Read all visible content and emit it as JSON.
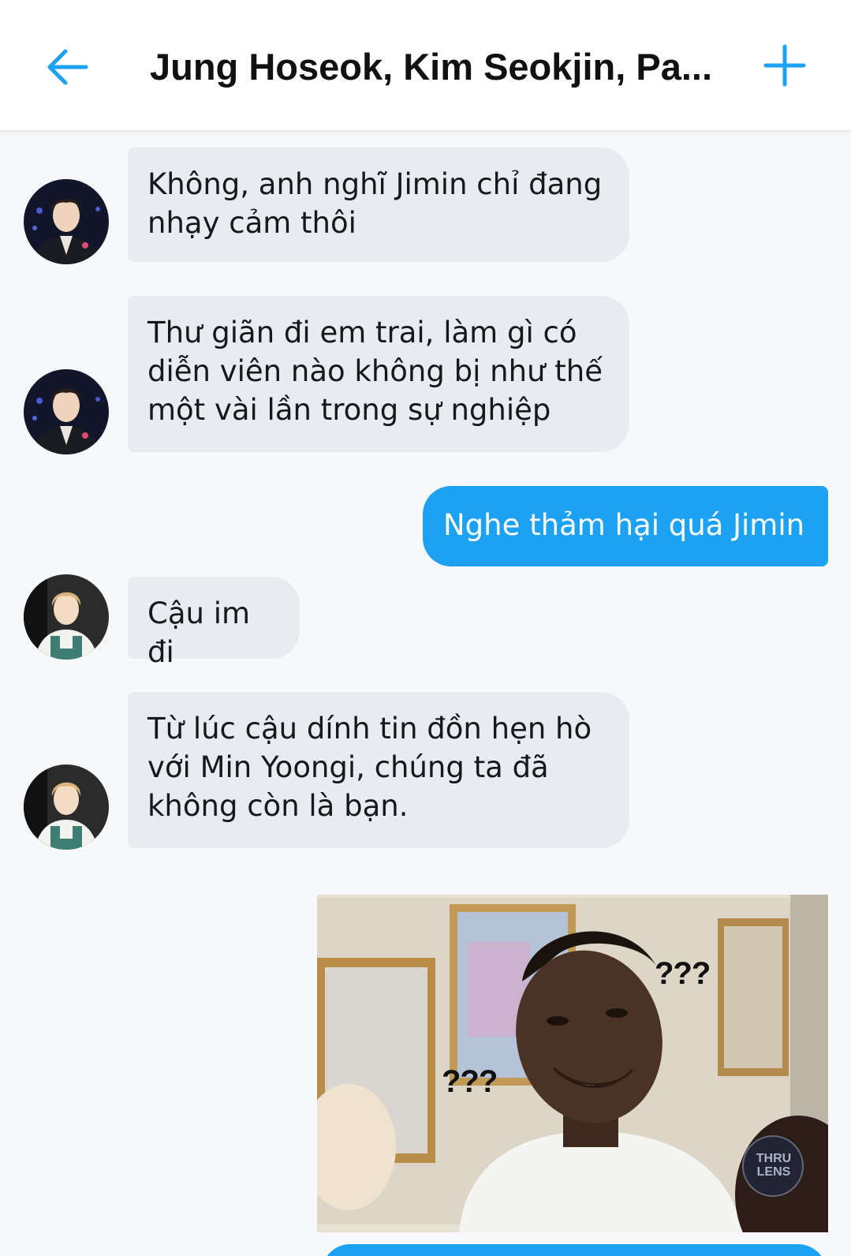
{
  "header": {
    "title": "Jung Hoseok, Kim Seokjin, Pa...",
    "accent": "#1da1f2",
    "back_icon": "arrow-left-icon",
    "add_icon": "plus-icon"
  },
  "messages": [
    {
      "direction": "incoming",
      "sender_avatar": "seokjin-avatar",
      "text": "Không, anh nghĩ Jimin chỉ đang nhạy cảm thôi"
    },
    {
      "direction": "incoming",
      "sender_avatar": "seokjin-avatar",
      "text": "Thư giãn đi em trai, làm gì có diễn viên nào không bị như thế một vài lần trong sự nghiệp"
    },
    {
      "direction": "outgoing",
      "text": "Nghe thảm hại quá Jimin"
    },
    {
      "direction": "incoming",
      "sender_avatar": "jimin-avatar",
      "text": "Cậu im đi"
    },
    {
      "direction": "incoming",
      "sender_avatar": "jimin-avatar",
      "text": "Từ lúc cậu dính tin đồn hẹn hò với Min Yoongi, chúng ta đã không còn là bạn."
    },
    {
      "direction": "outgoing",
      "type": "image",
      "caption_left": "???",
      "caption_right": "???",
      "watermark": "THRU LENS"
    }
  ],
  "colors": {
    "incoming_bubble": "#e8ebef",
    "outgoing_bubble": "#1da1f2",
    "background": "#f7f8fa"
  }
}
